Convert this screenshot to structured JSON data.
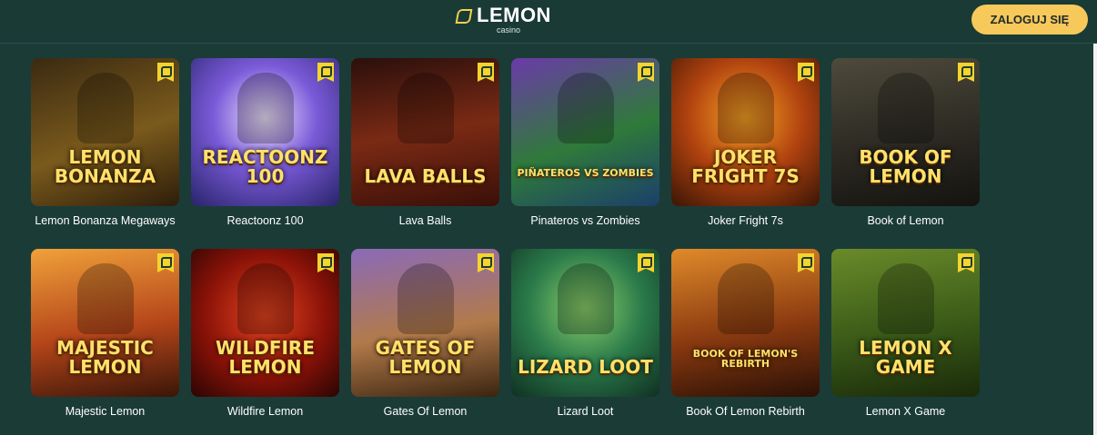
{
  "header": {
    "logo_word": "LEMON",
    "logo_sub": "casino",
    "login_label": "ZALOGUJ SIĘ"
  },
  "games": [
    {
      "name": "Lemon Bonanza Megaways",
      "art": "LEMON BONANZA",
      "bg": "linear-gradient(160deg,#3b2a12,#7a5a1c 55%,#2d1d0a)"
    },
    {
      "name": "Reactoonz 100",
      "art": "REACTOONZ 100",
      "bg": "radial-gradient(circle at 50% 40%,#f1e6ff,#7a5ad8 45%,#28246a)"
    },
    {
      "name": "Lava Balls",
      "art": "LAVA BALLS",
      "bg": "linear-gradient(170deg,#2b0f0c,#7a2a14 50%,#3a0f08)"
    },
    {
      "name": "Pinateros vs Zombies",
      "art": "PIÑATEROS VS ZOMBIES",
      "bg": "linear-gradient(160deg,#6b3aa8,#2f7a3a 55%,#1c3f6a)"
    },
    {
      "name": "Joker Fright 7s",
      "art": "JOKER FRIGHT 7s",
      "bg": "radial-gradient(circle at 50% 40%,#f7a124,#b0420f 50%,#3a1505)"
    },
    {
      "name": "Book of Lemon",
      "art": "BOOK OF LEMON",
      "bg": "linear-gradient(170deg,#4e4a3c,#2c2a22 55%,#15130f)"
    },
    {
      "name": "Majestic Lemon",
      "art": "MAJESTIC LEMON",
      "bg": "linear-gradient(170deg,#f0a13a,#b5461a 55%,#3a1508)"
    },
    {
      "name": "Wildfire Lemon",
      "art": "WILDFIRE LEMON",
      "bg": "radial-gradient(circle at 50% 45%,#e3441f,#8a1208 55%,#2a0503)"
    },
    {
      "name": "Gates Of Lemon",
      "art": "GATES OF LEMON",
      "bg": "linear-gradient(170deg,#8a6ab8,#b27a4a 55%,#3a2410)"
    },
    {
      "name": "Lizard Loot",
      "art": "LIZARD LOOT",
      "bg": "radial-gradient(circle at 50% 40%,#8cd06a,#2a7a4a 50%,#103022)"
    },
    {
      "name": "Book Of Lemon Rebirth",
      "art": "BOOK OF LEMON'S REBIRTH",
      "bg": "linear-gradient(170deg,#e08a2a,#8a3a10 55%,#2a1005)"
    },
    {
      "name": "Lemon X Game",
      "art": "LEMON X GAME",
      "bg": "linear-gradient(170deg,#6a8a2a,#3a5a18 55%,#1a2a0a)"
    }
  ]
}
